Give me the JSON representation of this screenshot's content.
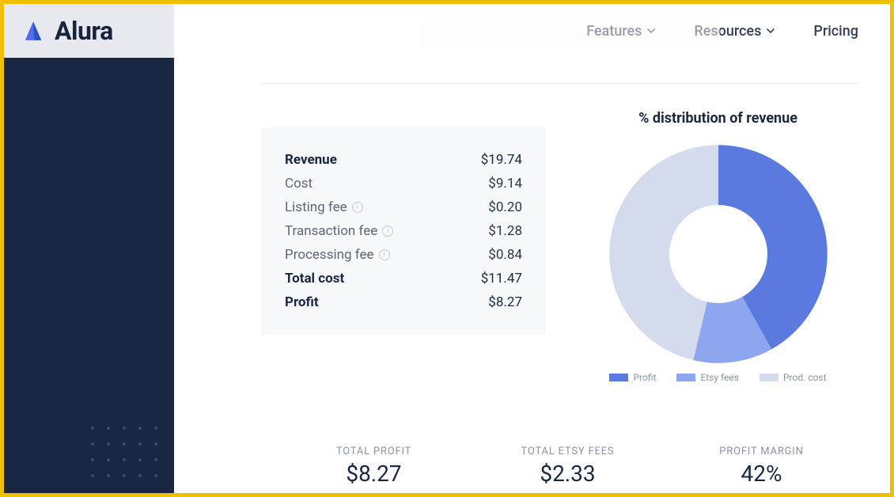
{
  "brand": {
    "name": "Alura"
  },
  "nav": {
    "features": "Features",
    "resources": "Resources",
    "pricing": "Pricing"
  },
  "calc": {
    "revenue_label": "Revenue",
    "revenue_value": "$19.74",
    "cost_label": "Cost",
    "cost_value": "$9.14",
    "listing_label": "Listing fee",
    "listing_value": "$0.20",
    "transaction_label": "Transaction fee",
    "transaction_value": "$1.28",
    "processing_label": "Processing fee",
    "processing_value": "$0.84",
    "totalcost_label": "Total cost",
    "totalcost_value": "$11.47",
    "profit_label": "Profit",
    "profit_value": "$8.27"
  },
  "chart": {
    "title": "% distribution of revenue",
    "legend": {
      "profit": "Profit",
      "fees": "Etsy fees",
      "cost": "Prod. cost"
    }
  },
  "totals": {
    "profit_label": "TOTAL PROFIT",
    "profit_value": "$8.27",
    "fees_label": "TOTAL ETSY FEES",
    "fees_value": "$2.33",
    "margin_label": "PROFIT MARGIN",
    "margin_value": "42%"
  },
  "colors": {
    "profit": "#5b7ae0",
    "fees": "#8ea6ef",
    "cost": "#d4dbec"
  },
  "chart_data": {
    "type": "pie",
    "title": "% distribution of revenue",
    "series": [
      {
        "name": "Profit",
        "value": 8.27,
        "percent": 41.9,
        "color": "#5b7ae0"
      },
      {
        "name": "Etsy fees",
        "value": 2.33,
        "percent": 11.8,
        "color": "#8ea6ef"
      },
      {
        "name": "Prod. cost",
        "value": 9.14,
        "percent": 46.3,
        "color": "#d4dbec"
      }
    ],
    "total": 19.74,
    "donut_inner_ratio": 0.45,
    "start_angle_deg": -90
  }
}
